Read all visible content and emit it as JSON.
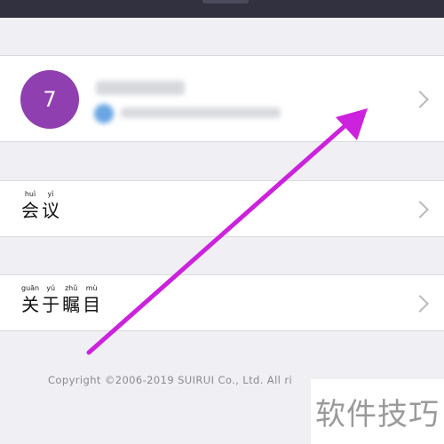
{
  "profile": {
    "avatar_text": "7"
  },
  "menu": {
    "meeting": [
      {
        "pinyin": "huì",
        "hanzi": "会"
      },
      {
        "pinyin": "yì",
        "hanzi": "议"
      }
    ],
    "about": [
      {
        "pinyin": "guān",
        "hanzi": "关"
      },
      {
        "pinyin": "yú",
        "hanzi": "于"
      },
      {
        "pinyin": "zhǔ",
        "hanzi": "瞩"
      },
      {
        "pinyin": "mù",
        "hanzi": "目"
      }
    ]
  },
  "footer": {
    "copyright": "Copyright ©2006-2019 SUIRUI Co., Ltd. All ri"
  },
  "watermark": {
    "text": "软件技巧"
  },
  "annotation": {
    "arrow_color": "#cc22dd"
  },
  "colors": {
    "avatar_bg": "#8f3fb0",
    "topbar": "#31313f",
    "page_bg": "#efeff4"
  }
}
